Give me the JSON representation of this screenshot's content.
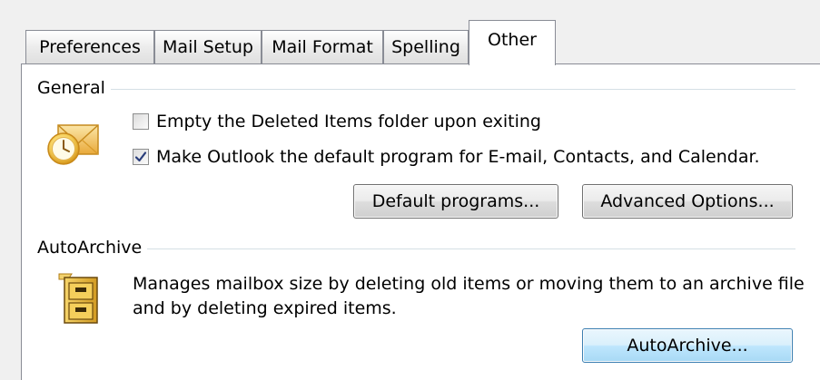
{
  "tabs": [
    {
      "label": "Preferences"
    },
    {
      "label": "Mail Setup"
    },
    {
      "label": "Mail Format"
    },
    {
      "label": "Spelling"
    },
    {
      "label": "Other",
      "active": true
    }
  ],
  "general": {
    "label": "General",
    "icon": "outlook-clock-envelope-icon",
    "empty_deleted": {
      "label": "Empty the Deleted Items folder upon exiting",
      "checked": false
    },
    "default_program": {
      "label": "Make Outlook the default program for E-mail, Contacts, and Calendar.",
      "checked": true
    },
    "default_programs_button": "Default programs...",
    "advanced_options_button": "Advanced Options..."
  },
  "autoarchive": {
    "label": "AutoArchive",
    "icon": "archive-cabinet-icon",
    "description_line1": "Manages mailbox size by deleting old items or moving them to an archive file",
    "description_line2": "and by deleting expired items.",
    "button": "AutoArchive..."
  },
  "colors": {
    "tab_border": "#898c95",
    "group_line": "#d5dfe5",
    "focus_button": "#bee6fd",
    "checkmark": "#2a3e7b"
  }
}
